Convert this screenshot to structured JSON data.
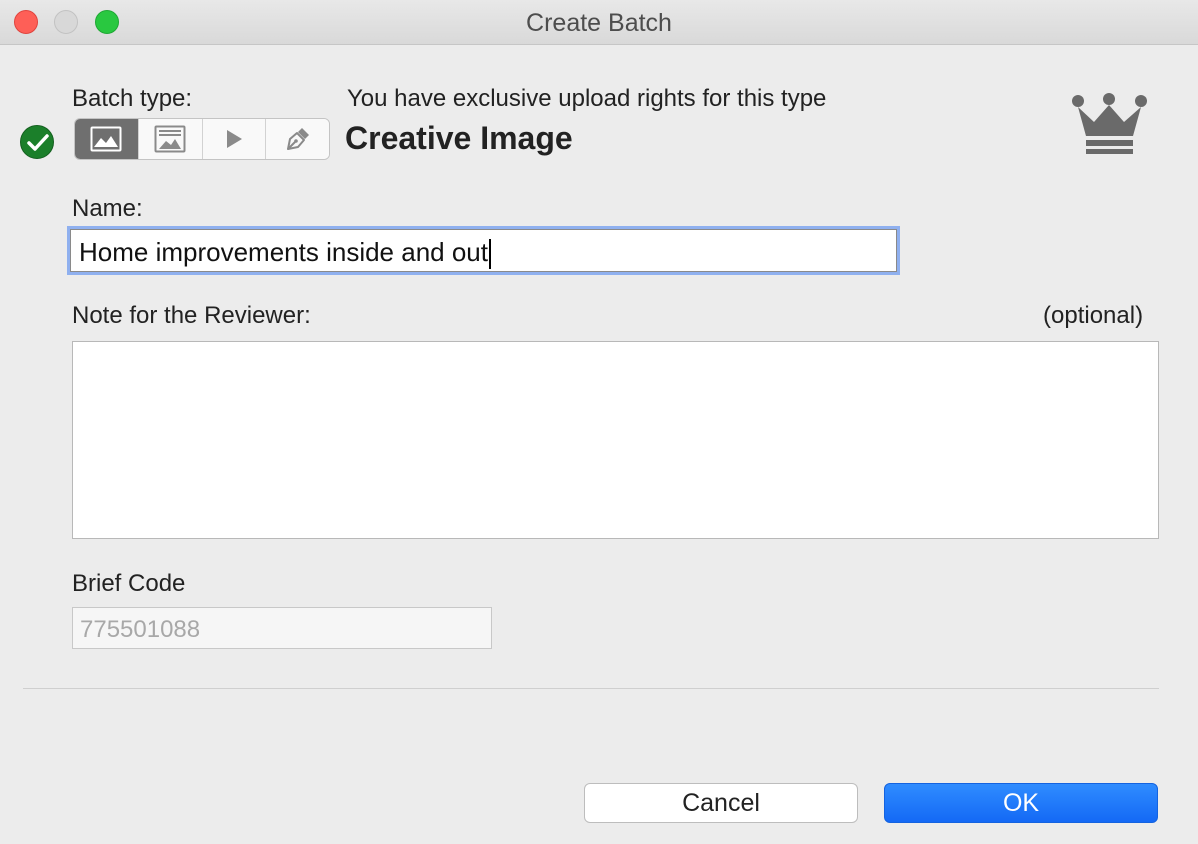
{
  "window": {
    "title": "Create Batch",
    "controls": [
      "close",
      "minimize",
      "maximize"
    ]
  },
  "batch_type": {
    "label": "Batch type:",
    "rights_message": "You have exclusive upload rights for this type",
    "selected_name": "Creative Image",
    "options": [
      {
        "icon": "image-icon",
        "selected": true
      },
      {
        "icon": "editorial-image-icon",
        "selected": false
      },
      {
        "icon": "play-video-icon",
        "selected": false
      },
      {
        "icon": "pen-illustration-icon",
        "selected": false
      }
    ],
    "status_icon": "checkmark-icon",
    "badge_icon": "crown-icon"
  },
  "name": {
    "label": "Name:",
    "value": "Home improvements inside and out"
  },
  "note": {
    "label": "Note for the Reviewer:",
    "optional_label": "(optional)",
    "value": ""
  },
  "brief_code": {
    "label": "Brief Code",
    "placeholder": "775501088"
  },
  "buttons": {
    "cancel": "Cancel",
    "ok": "OK"
  },
  "colors": {
    "accent": "#1a73f5",
    "success": "#1b7f2a",
    "focus_ring": "#8fb0ef"
  }
}
